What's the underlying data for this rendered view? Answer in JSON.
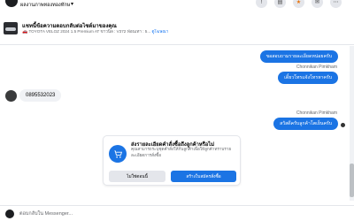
{
  "topbar": {
    "page_name": "ผลงานภาพทองทองทักษ",
    "caret": "▾",
    "actions": [
      "!",
      "▤",
      "★",
      "✉",
      "⋯"
    ]
  },
  "chat_header": {
    "title": "แชทนี้ข้อความตอบกลับต่อไซต์มาของคุณ",
    "car_emoji": "🚗",
    "subtitle": "TOYOTA VELOZ 2024 1.5 Premium AT ขาวนิล : V372 ฟ่อนเทา : 5...",
    "link": "ดูโฆษณา"
  },
  "messages": {
    "out1": "ขอสอบถามรายละเอียดหน่อยครับ",
    "sender1": "Chonnikan Pimkham",
    "out2": "เดี๋ยวโทรแจ้งโทรหาครับ",
    "in1": "0895532023",
    "sender2": "Chonnikan Pimkham",
    "out3": "สวัสดีครับลูกค้าโตเย็นครับ"
  },
  "banner": {
    "title": "ส่งรายละเอียดคำสั่งซื้อถึงลูกค้าหรือไม่",
    "description": "คุณสามารถระบุชุดคำสั่งให้กับลูกค้าเพื่อให้ลูกค้าทราบรายละเอียดการสั่งซื้อ",
    "btn_left": "ไม่ใช่ตอนนี้",
    "btn_right": "สร้างใบสมัครสั่งซื้อ"
  },
  "composer": {
    "placeholder": "ตอบกลับใน Messenger..."
  },
  "colors": {
    "accent": "#1b74e4",
    "bubble_in": "#f0f2f5"
  }
}
